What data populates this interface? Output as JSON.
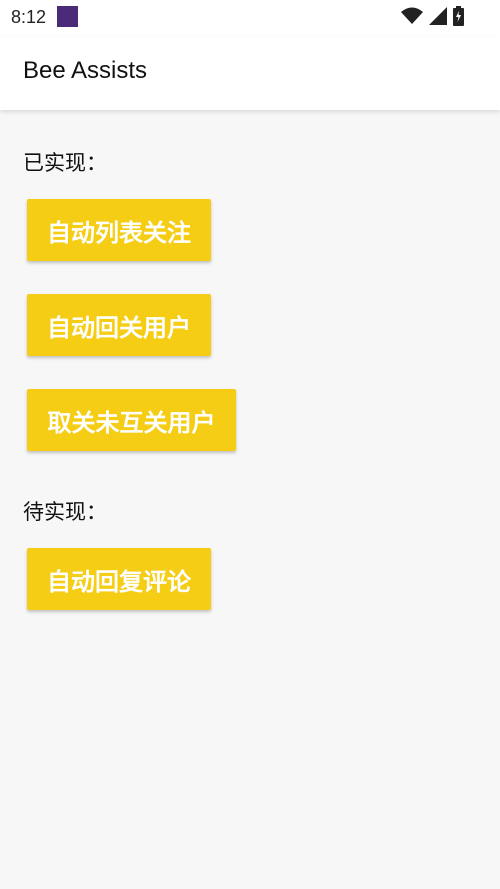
{
  "status_bar": {
    "time": "8:12",
    "icons": [
      "app-notification-icon",
      "wifi-icon",
      "cell-signal-icon",
      "battery-icon"
    ]
  },
  "app_bar": {
    "title": "Bee Assists"
  },
  "sections": {
    "implemented": {
      "label": "已实现：",
      "buttons": [
        "自动列表关注",
        "自动回关用户",
        "取关未互关用户"
      ]
    },
    "pending": {
      "label": "待实现：",
      "buttons": [
        "自动回复评论"
      ]
    }
  },
  "colors": {
    "button": "#f5cd14",
    "background": "#f7f7f7"
  }
}
